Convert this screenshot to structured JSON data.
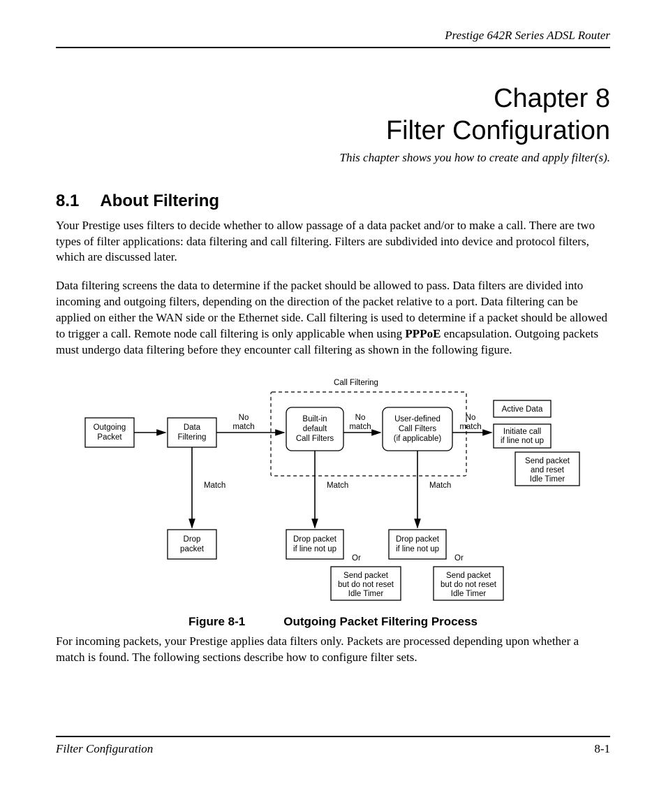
{
  "header": {
    "running_title": "Prestige 642R Series ADSL Router"
  },
  "chapter": {
    "line1": "Chapter 8",
    "line2": "Filter Configuration",
    "subtitle": "This chapter shows you how to create and apply filter(s)."
  },
  "section": {
    "number": "8.1",
    "title": "About Filtering"
  },
  "para1": "Your Prestige uses filters to decide whether to allow passage of a data packet and/or to make a call. There are two types of filter applications: data filtering and call filtering. Filters are subdivided into device and protocol filters, which are discussed later.",
  "para2a": "Data filtering screens the data to determine if the packet should be allowed to pass. Data filters are divided into incoming and outgoing filters, depending on the direction of the packet relative to a port. Data filtering can be applied on either the WAN side or the Ethernet side. Call filtering is used to determine if a packet should be allowed to trigger a call. Remote node call filtering is only applicable when using ",
  "para2_bold": "PPPoE",
  "para2b": " encapsulation. Outgoing packets must undergo data filtering before they encounter call filtering as shown in the following figure.",
  "diagram": {
    "call_filtering_label": "Call Filtering",
    "outgoing_packet": [
      "Outgoing",
      "Packet"
    ],
    "data_filtering": [
      "Data",
      "Filtering"
    ],
    "builtin": [
      "Built-in",
      "default",
      "Call Filters"
    ],
    "userdef": [
      "User-defined",
      "Call Filters",
      "(if applicable)"
    ],
    "active_data": "Active Data",
    "initiate_call": [
      "Initiate call",
      "if line not up"
    ],
    "send_reset": [
      "Send packet",
      "and reset",
      "Idle Timer"
    ],
    "no_match": "No",
    "no_match2": "match",
    "match": "Match",
    "drop_packet": [
      "Drop",
      "packet"
    ],
    "drop_if_line": [
      "Drop packet",
      "if line not up"
    ],
    "or": "Or",
    "send_noreset": [
      "Send packet",
      "but do not reset",
      "Idle Timer"
    ]
  },
  "figure_caption": {
    "label": "Figure 8-1",
    "title": "Outgoing Packet Filtering Process"
  },
  "para3": "For incoming packets, your Prestige applies data filters only. Packets are processed depending upon whether a match is found. The following sections describe how to configure filter sets.",
  "footer": {
    "left": "Filter Configuration",
    "page": "8-1"
  }
}
